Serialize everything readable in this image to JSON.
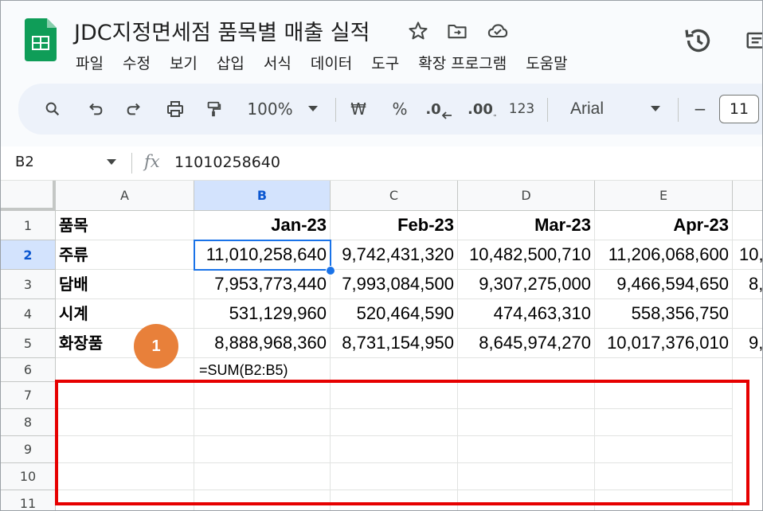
{
  "doc": {
    "title": "JDC지정면세점 품목별 매출 실적"
  },
  "menu": [
    "파일",
    "수정",
    "보기",
    "삽입",
    "서식",
    "데이터",
    "도구",
    "확장 프로그램",
    "도움말"
  ],
  "toolbar": {
    "zoom": "100%",
    "currency": "₩",
    "percent": "%",
    "dec_decrease": ".0",
    "dec_increase": ".00",
    "number_format": "123",
    "font": "Arial",
    "minus": "−",
    "font_size": "11"
  },
  "formula_bar": {
    "cell_ref": "B2",
    "fx": "fx",
    "value": "11010258640"
  },
  "columns": [
    "A",
    "B",
    "C",
    "D",
    "E"
  ],
  "rows": [
    "1",
    "2",
    "3",
    "4",
    "5",
    "6",
    "7",
    "8",
    "9",
    "10",
    "11"
  ],
  "table": {
    "header": [
      "품목",
      "Jan-23",
      "Feb-23",
      "Mar-23",
      "Apr-23"
    ],
    "data": [
      [
        "주류",
        "11,010,258,640",
        "9,742,431,320",
        "10,482,500,710",
        "11,206,068,600",
        "10,"
      ],
      [
        "담배",
        "7,953,773,440",
        "7,993,084,500",
        "9,307,275,000",
        "9,466,594,650",
        "8,"
      ],
      [
        "시계",
        "531,129,960",
        "520,464,590",
        "474,463,310",
        "558,356,750",
        ""
      ],
      [
        "화장품",
        "8,888,968,360",
        "8,731,154,950",
        "8,645,974,270",
        "10,017,376,010",
        "9,"
      ]
    ],
    "formula_cell": "=SUM(B2:B5)"
  },
  "selection": {
    "active_cell": "B2",
    "column": "B",
    "row": "2"
  },
  "annotation": {
    "step": "1"
  },
  "colors": {
    "accent": "#1a73e8",
    "highlight": "#d3e3fd",
    "callout": "#e8803a",
    "box": "#e60000",
    "sheets_green": "#0f9d58"
  }
}
